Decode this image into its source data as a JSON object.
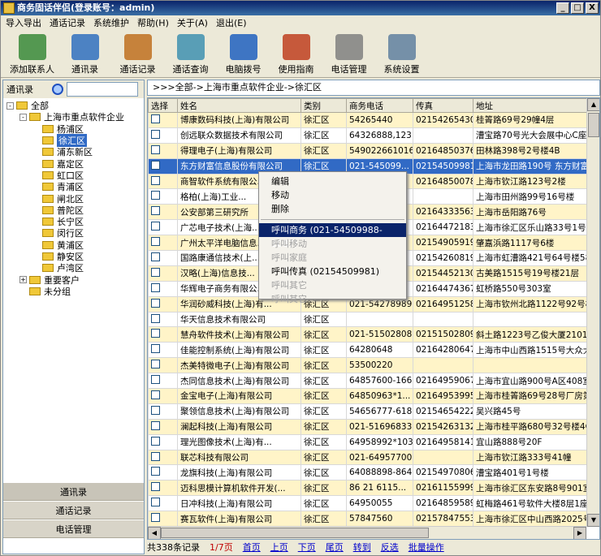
{
  "window": {
    "title": "商务固话伴侣(登录账号：admin)",
    "min": "_",
    "max": "□",
    "close": "X"
  },
  "menu": [
    "导入导出",
    "通话记录",
    "系统维护",
    "帮助(H)",
    "关于(A)",
    "退出(E)"
  ],
  "toolbar": [
    {
      "label": "添加联系人",
      "icon": "add-contact-icon",
      "color": "#3a8a3a"
    },
    {
      "label": "通讯录",
      "icon": "address-book-icon",
      "color": "#3070c0"
    },
    {
      "label": "通话记录",
      "icon": "call-log-icon",
      "color": "#c07020"
    },
    {
      "label": "通话查询",
      "icon": "call-search-icon",
      "color": "#4090b0"
    },
    {
      "label": "电脑拨号",
      "icon": "pc-dial-icon",
      "color": "#2060c0"
    },
    {
      "label": "使用指南",
      "icon": "guide-icon",
      "color": "#c04020"
    },
    {
      "label": "电话管理",
      "icon": "phone-manage-icon",
      "color": "#808080"
    },
    {
      "label": "系统设置",
      "icon": "settings-icon",
      "color": "#6080a0"
    }
  ],
  "left": {
    "search_label": "通讯录",
    "search_value": "",
    "tree": [
      {
        "label": "全部",
        "level": 0,
        "exp": "-"
      },
      {
        "label": "上海市重点软件企业",
        "level": 1,
        "exp": "-"
      },
      {
        "label": "杨浦区",
        "level": 2
      },
      {
        "label": "徐汇区",
        "level": 2,
        "selected": true
      },
      {
        "label": "浦东新区",
        "level": 2
      },
      {
        "label": "嘉定区",
        "level": 2
      },
      {
        "label": "虹口区",
        "level": 2
      },
      {
        "label": "青浦区",
        "level": 2
      },
      {
        "label": "闸北区",
        "level": 2
      },
      {
        "label": "普陀区",
        "level": 2
      },
      {
        "label": "长宁区",
        "level": 2
      },
      {
        "label": "闵行区",
        "level": 2
      },
      {
        "label": "黄浦区",
        "level": 2
      },
      {
        "label": "静安区",
        "level": 2
      },
      {
        "label": "卢湾区",
        "level": 2
      },
      {
        "label": "重要客户",
        "level": 1,
        "exp": "+"
      },
      {
        "label": "未分组",
        "level": 1
      }
    ],
    "nav": [
      "通讯录",
      "通话记录",
      "电话管理"
    ]
  },
  "breadcrumb": ">>>全部->上海市重点软件企业->徐汇区",
  "table": {
    "headers": [
      "选择",
      "姓名",
      "类别",
      "商务电话",
      "传真",
      "地址"
    ],
    "rows": [
      [
        "博康数码科技(上海)有限公司",
        "徐汇区",
        "54265440",
        "02154265430",
        "桂箐路69号29幢4层"
      ],
      [
        "创远联众数据技术有限公司",
        "徐汇区",
        "64326888,123",
        "",
        "漕宝路70号光大会展中心C座2"
      ],
      [
        "得理电子(上海)有限公司",
        "徐汇区",
        "549022661016",
        "02164850376",
        "田林路398号2号楼4B"
      ],
      [
        "东方财富信息股份有限公司",
        "徐汇区",
        "021-545099...",
        "02154509981",
        "上海市龙田路190号 东方财富"
      ],
      [
        "商智软件系统有限公...",
        "徐汇区",
        "",
        "02164850078",
        "上海市钦江路123号2楼"
      ],
      [
        "格柏(上海)工业...",
        "徐汇区",
        "",
        "",
        "上海市田州路99号16号楼"
      ],
      [
        "公安部第三研究所",
        "徐汇区",
        "",
        "02164333563",
        "上海市岳阳路76号"
      ],
      [
        "广芯电子技术(上海...",
        "徐汇区",
        "",
        "02164472183",
        "上海市徐汇区乐山路33号1号"
      ],
      [
        "广州太平洋电脑信息...",
        "徐汇区",
        "",
        "02154905919",
        "肇嘉浜路1117号6楼"
      ],
      [
        "国路康通信技术(上...",
        "徐汇区",
        "",
        "02154260819",
        "上海市虹漕路421号64号楼5楼"
      ],
      [
        "汉略(上海)信息技...",
        "徐汇区",
        "",
        "02154452130",
        "古美路1515号19号楼21层"
      ],
      [
        "华辉电子商务有限公...",
        "徐汇区",
        "",
        "02164474367",
        "虹桥路550号303室"
      ],
      [
        "华润砂威科技(上海)有...",
        "徐汇区",
        "021-54278989",
        "02164951258",
        "上海市钦州北路1122号92号楼"
      ],
      [
        "华天信息技术有限公司",
        "徐汇区",
        "",
        "",
        ""
      ],
      [
        "慧舟软件技术(上海)有限公司",
        "徐汇区",
        "021-51502808",
        "02151502809",
        "斜土路1223号乙俊大厦2101-2"
      ],
      [
        "佳能控制系统(上海)有限公司",
        "徐汇区",
        "64280648",
        "02164280647",
        "上海市中山西路1515号大众大"
      ],
      [
        "杰美特微电子(上海)有限公司",
        "徐汇区",
        "53500220",
        "",
        ""
      ],
      [
        "杰同信息技术(上海)有限公司",
        "徐汇区",
        "64857600-166",
        "02164959067",
        "上海市宜山路900号A区408室"
      ],
      [
        "金宝电子(上海)有限公司",
        "徐汇区",
        "64850963*1...",
        "02164953995",
        "上海市桂箐路69号28号厂房第"
      ],
      [
        "聚领信息技术(上海)有限公司",
        "徐汇区",
        "54656777-618",
        "02154654222",
        "吴兴路45号"
      ],
      [
        "澜起科技(上海)有限公司",
        "徐汇区",
        "021-51696833",
        "02154263132",
        "上海市桂平路680号32号楼4C"
      ],
      [
        "理光图像技术(上海)有...",
        "徐汇区",
        "64958992*103",
        "02164958141",
        "宜山路888号20F"
      ],
      [
        "联芯科技有限公司",
        "徐汇区",
        "021-64957700",
        "",
        "上海市钦江路333号41幢"
      ],
      [
        "龙旗科技(上海)有限公司",
        "徐汇区",
        "64088898-8640",
        "02154970806",
        "漕宝路401号1号楼"
      ],
      [
        "迈科思模计算机软件开发(...",
        "徐汇区",
        "86 21 6115...",
        "02161155999",
        "上海市徐汇区东安路8号901室"
      ],
      [
        "日冲科技(上海)有限公司",
        "徐汇区",
        "64950055",
        "02164859589",
        "虹梅路461号软件大楼8层1座"
      ],
      [
        "赛瓦软件(上海)有限公司",
        "徐汇区",
        "57847560",
        "02157847553",
        "上海市徐汇区中山西路2025号"
      ]
    ]
  },
  "context_menu": {
    "items": [
      {
        "label": "编辑",
        "state": "normal"
      },
      {
        "label": "移动",
        "state": "normal"
      },
      {
        "label": "删除",
        "state": "normal"
      },
      {
        "sep": true
      },
      {
        "label": "呼叫商务 (021-54509988-1087)",
        "state": "highlight"
      },
      {
        "label": "呼叫移动",
        "state": "disabled"
      },
      {
        "label": "呼叫家庭",
        "state": "disabled"
      },
      {
        "label": "呼叫传真 (02154509981)",
        "state": "normal"
      },
      {
        "label": "呼叫其它",
        "state": "disabled"
      },
      {
        "label": "呼叫其它",
        "state": "disabled"
      }
    ]
  },
  "status": {
    "total": "共338条记录",
    "page": "1/7页",
    "links": [
      "首页",
      "上页",
      "下页",
      "尾页",
      "转到",
      "反选",
      "批量操作"
    ]
  }
}
